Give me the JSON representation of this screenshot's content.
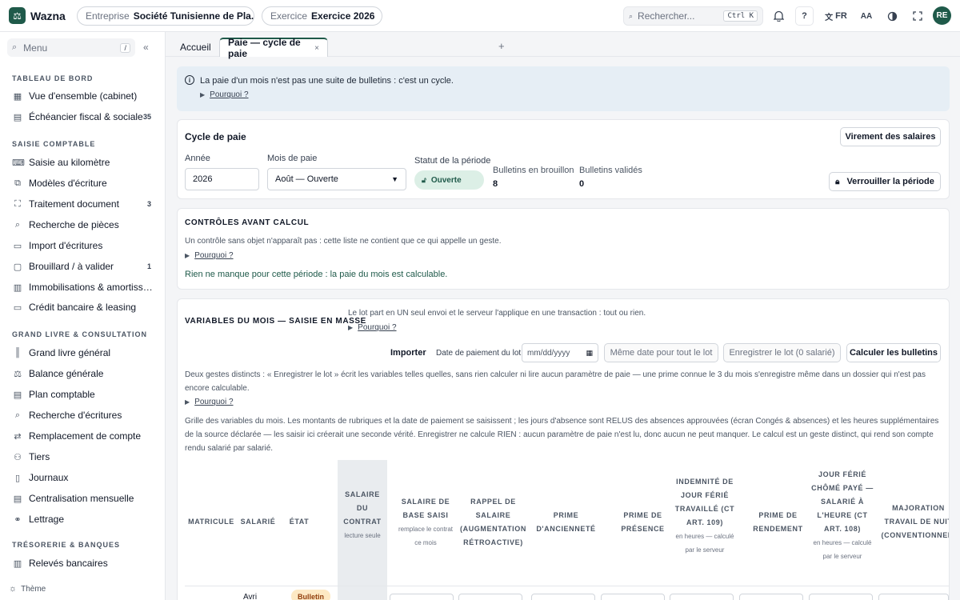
{
  "topbar": {
    "logo_glyph": "⚖",
    "brand": "Wazna",
    "entreprise_key": "Entreprise",
    "entreprise_value": "Société Tunisienne de Pla...",
    "exercice_key": "Exercice",
    "exercice_value": "Exercice 2026",
    "search_placeholder": "Rechercher...",
    "search_shortcut": "Ctrl K",
    "help_label": "?",
    "lang_label": "FR",
    "font_label": "AA",
    "avatar_initials": "RE"
  },
  "sidebar": {
    "menu_placeholder": "Menu",
    "menu_shortcut": "/",
    "sections": {
      "tableau": "TABLEAU DE BORD",
      "saisie": "SAISIE COMPTABLE",
      "grand_livre": "GRAND LIVRE & CONSULTATION",
      "tresorerie": "TRÉSORERIE & BANQUES"
    },
    "items": [
      {
        "label": "Vue d'ensemble (cabinet)",
        "icon": "grid-icon",
        "badge": ""
      },
      {
        "label": "Échéancier fiscal & sociale",
        "icon": "calendar-icon",
        "badge": "35"
      },
      {
        "label": "Saisie au kilomètre",
        "icon": "keyboard-icon",
        "badge": ""
      },
      {
        "label": "Modèles d'écriture",
        "icon": "template-icon",
        "badge": ""
      },
      {
        "label": "Traitement document",
        "icon": "scan-icon",
        "badge": "3"
      },
      {
        "label": "Recherche de pièces",
        "icon": "search-icon",
        "badge": ""
      },
      {
        "label": "Import d'écritures",
        "icon": "import-icon",
        "badge": ""
      },
      {
        "label": "Brouillard / à valider",
        "icon": "draft-icon",
        "badge": "1"
      },
      {
        "label": "Immobilisations & amortissements",
        "icon": "building-icon",
        "badge": ""
      },
      {
        "label": "Crédit bancaire & leasing",
        "icon": "card-icon",
        "badge": ""
      },
      {
        "label": "Grand livre général",
        "icon": "books-icon",
        "badge": ""
      },
      {
        "label": "Balance générale",
        "icon": "scale-icon",
        "badge": ""
      },
      {
        "label": "Plan comptable",
        "icon": "list-icon",
        "badge": ""
      },
      {
        "label": "Recherche d'écritures",
        "icon": "search-icon",
        "badge": ""
      },
      {
        "label": "Remplacement de compte",
        "icon": "swap-icon",
        "badge": ""
      },
      {
        "label": "Tiers",
        "icon": "users-icon",
        "badge": ""
      },
      {
        "label": "Journaux",
        "icon": "book-icon",
        "badge": ""
      },
      {
        "label": "Centralisation mensuelle",
        "icon": "doc-icon",
        "badge": ""
      },
      {
        "label": "Lettrage",
        "icon": "link-icon",
        "badge": ""
      },
      {
        "label": "Relevés bancaires",
        "icon": "bank-icon",
        "badge": ""
      }
    ],
    "theme_label": "Thème"
  },
  "tabs": {
    "home": "Accueil",
    "active": "Paie — cycle de paie",
    "close": "×",
    "add": "+"
  },
  "banner": {
    "text": "La paie d'un mois n'est pas une suite de bulletins : c'est un cycle.",
    "why": "Pourquoi ?"
  },
  "cycle": {
    "title": "Cycle de paie",
    "virement_button": "Virement des salaires",
    "annee_label": "Année",
    "annee_value": "2026",
    "mois_label": "Mois de paie",
    "mois_value": "Août — Ouverte",
    "statut_label": "Statut de la période",
    "statut_value": "Ouverte",
    "brouillon_label": "Bulletins en brouillon",
    "brouillon_value": "8",
    "valides_label": "Bulletins validés",
    "valides_value": "0",
    "verrouiller_button": "Verrouiller la période"
  },
  "controles": {
    "title": "CONTRÔLES AVANT CALCUL",
    "text": "Un contrôle sans objet n'apparaît pas : cette liste ne contient que ce qui appelle un geste.",
    "why": "Pourquoi ?",
    "ok": "Rien ne manque pour cette période : la paie du mois est calculable."
  },
  "variables": {
    "title": "VARIABLES DU MOIS — SAISIE EN MASSE",
    "lot_text": "Le lot part en UN seul envoi et le serveur l'applique en une transaction : tout ou rien.",
    "why": "Pourquoi ?",
    "importer": "Importer",
    "date_label": "Date de paiement du lot",
    "date_placeholder": "mm/dd/yyyy",
    "meme_date": "Même date pour tout le lot",
    "enregistrer": "Enregistrer le lot (0 salarié)",
    "calculer": "Calculer les bulletins",
    "gestes_text": "Deux gestes distincts : « Enregistrer le lot » écrit les variables telles quelles, sans rien calculer ni lire aucun paramètre de paie — une prime connue le 3 du mois s'enregistre même dans un dossier qui n'est pas encore calculable.",
    "why2": "Pourquoi ?",
    "grille_text": "Grille des variables du mois. Les montants de rubriques et la date de paiement se saisissent ; les jours d'absence sont RELUS des absences approuvées (écran Congés & absences) et les heures supplémentaires de la source déclarée — les saisir ici créerait une seconde vérité. Enregistrer ne calcule RIEN : aucun paramètre de paie n'est lu, donc aucun ne peut manquer. Le calcul est un geste distinct, qui rend son compte rendu salarié par salarié."
  },
  "grid": {
    "h_matricule": "MATRICULE",
    "h_salarie": "SALARIÉ",
    "h_etat": "ÉTAT",
    "h_contrat": "SALAIRE DU CONTRAT",
    "h_contrat_sub": "lecture seule",
    "h_base": "SALAIRE DE BASE SAISI",
    "h_base_sub": "remplace le contrat ce mois",
    "h_rappel": "RAPPEL DE SALAIRE (AUGMENTATION RÉTROACTIVE)",
    "h_anciennete": "PRIME D'ANCIENNETÉ",
    "h_presence": "PRIME DE PRÉSENCE",
    "h_ferie": "INDEMNITÉ DE JOUR FÉRIÉ TRAVAILLÉ (CT ART. 109)",
    "h_ferie_sub": "en heures — calculé par le serveur",
    "h_rendement": "PRIME DE RENDEMENT",
    "h_chome": "JOUR FÉRIÉ CHÔMÉ PAYÉ — SALARIÉ À L'HEURE (CT ART. 108)",
    "h_chome_sub": "en heures — calculé par le serveur",
    "h_majoration": "MAJORATION TRAVAIL DE NUIT (CONVENTIONNEL)",
    "row1_salarie": "Avri",
    "row1_etat": "Bulletin"
  }
}
